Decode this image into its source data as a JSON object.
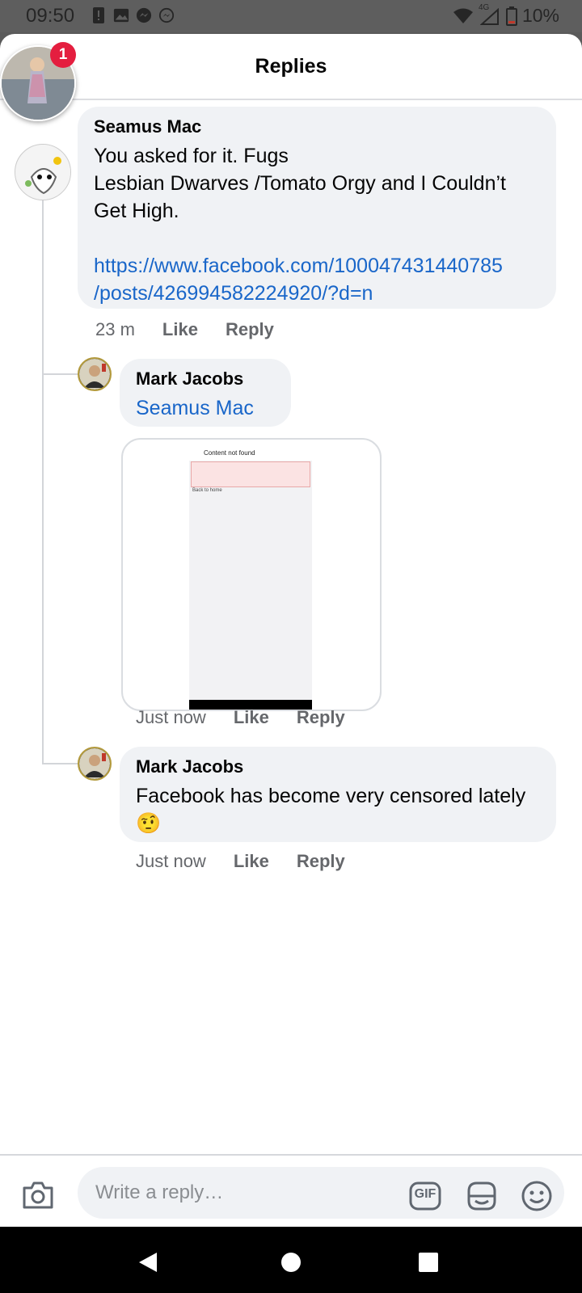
{
  "status_bar": {
    "time": "09:50",
    "network": "4G",
    "battery": "10%"
  },
  "sheet": {
    "title": "Replies",
    "chat_head_badge": "1"
  },
  "comments": [
    {
      "author": "Seamus Mac",
      "text": "You asked for it. Fugs\nLesbian Dwarves /Tomato Orgy and I Couldn’t Get High.",
      "link_line1": "https://www.facebook.com/100047431440785",
      "link_line2": "/posts/426994582224920/?d=n",
      "time": "23 m",
      "like": "Like",
      "reply": "Reply"
    },
    {
      "author": "Mark Jacobs",
      "mention": "Seamus Mac",
      "attachment": {
        "title": "Content not found",
        "home_link": "Back to home"
      },
      "time": "Just now",
      "like": "Like",
      "reply": "Reply"
    },
    {
      "author": "Mark Jacobs",
      "text": "Facebook has become very censored lately 🤨",
      "time": "Just now",
      "like": "Like",
      "reply": "Reply"
    }
  ],
  "composer": {
    "placeholder": "Write a reply…",
    "gif_label": "GIF"
  },
  "colors": {
    "link": "#1966c9",
    "badge": "#e41e3f",
    "bubble": "#f0f2f5",
    "secondary_text": "#65676b"
  }
}
